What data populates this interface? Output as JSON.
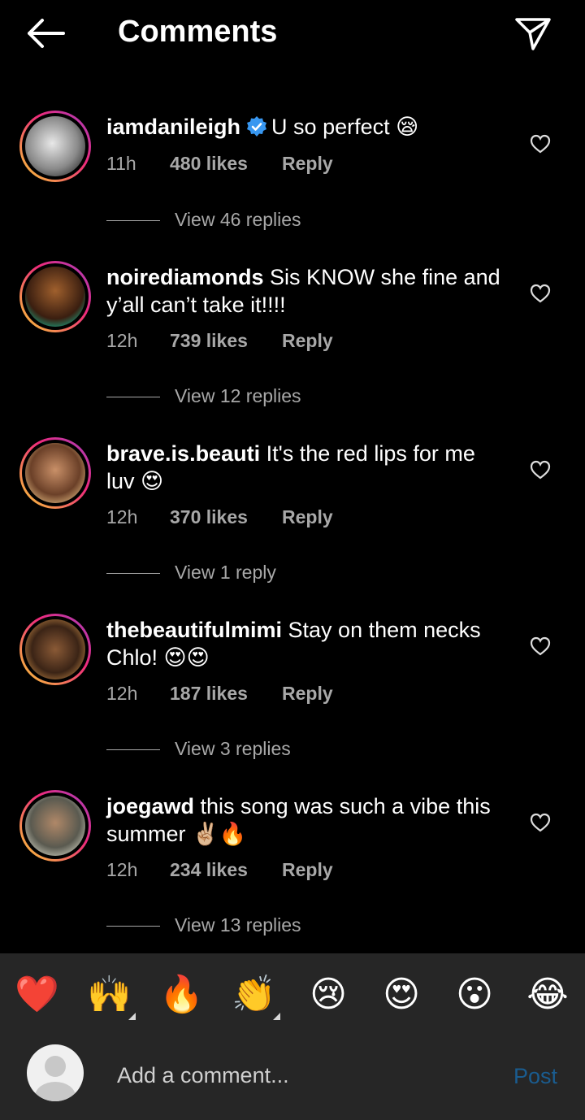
{
  "header": {
    "title": "Comments"
  },
  "comments": [
    {
      "user": "iamdanileigh",
      "verified": true,
      "text": "U so perfect 😪",
      "time": "11h",
      "likes": "480 likes",
      "reply": "Reply",
      "view_replies": "View 46 replies"
    },
    {
      "user": "noirediamonds",
      "verified": false,
      "text": "Sis KNOW she fine and y’all can’t take it!!!!",
      "time": "12h",
      "likes": "739 likes",
      "reply": "Reply",
      "view_replies": "View 12 replies"
    },
    {
      "user": "brave.is.beauti",
      "verified": false,
      "text": "It's the red lips for me luv 😍",
      "time": "12h",
      "likes": "370 likes",
      "reply": "Reply",
      "view_replies": "View 1 reply"
    },
    {
      "user": "thebeautifulmimi",
      "verified": false,
      "text": "Stay on them necks Chlo! 😍😍",
      "time": "12h",
      "likes": "187 likes",
      "reply": "Reply",
      "view_replies": "View 3 replies"
    },
    {
      "user": "joegawd",
      "verified": false,
      "text": "this song was such a vibe this summer ✌🏼🔥",
      "time": "12h",
      "likes": "234 likes",
      "reply": "Reply",
      "view_replies": "View 13 replies"
    }
  ],
  "quick_emojis": [
    "❤️",
    "🙌",
    "🔥",
    "👏",
    "😢",
    "😍",
    "😮",
    "😂"
  ],
  "composer": {
    "placeholder": "Add a comment...",
    "post_label": "Post"
  },
  "colors": {
    "background": "#000000",
    "composer_bar": "#262626",
    "post_disabled": "#1a5c8f",
    "verified": "#3897f0"
  }
}
